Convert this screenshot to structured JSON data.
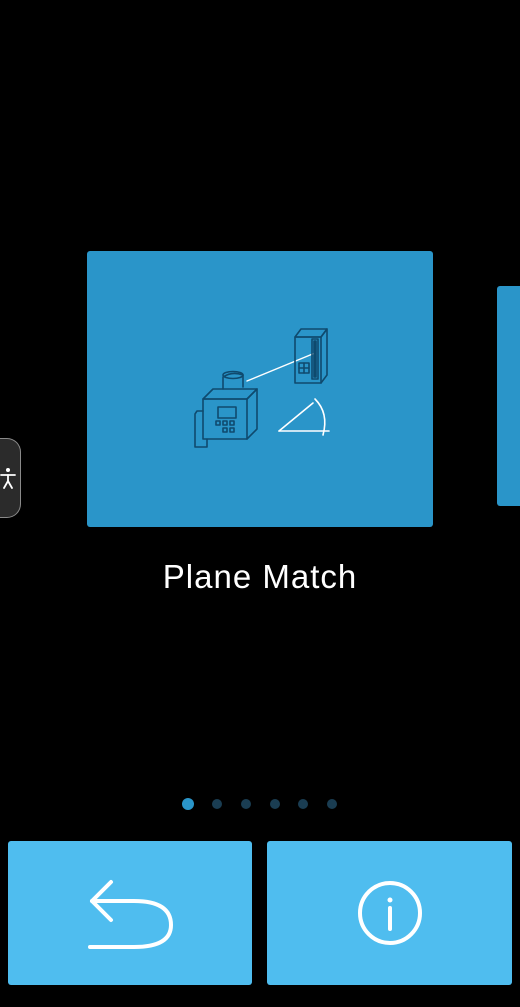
{
  "carousel": {
    "current_item": {
      "title": "Plane Match",
      "icon": "plane-match-illustration-icon"
    },
    "next_item_partially_visible": true,
    "page_count": 6,
    "current_page": 1
  },
  "accessibility_tab": {
    "icon": "accessibility-person-icon"
  },
  "buttons": {
    "back": {
      "icon": "undo-back-arrow-icon"
    },
    "info": {
      "icon": "info-circle-icon"
    }
  },
  "colors": {
    "background": "#000000",
    "card": "#2a95c9",
    "button": "#4fbdef",
    "dot_active": "#2a95c9",
    "dot_inactive": "#1a3d52"
  }
}
